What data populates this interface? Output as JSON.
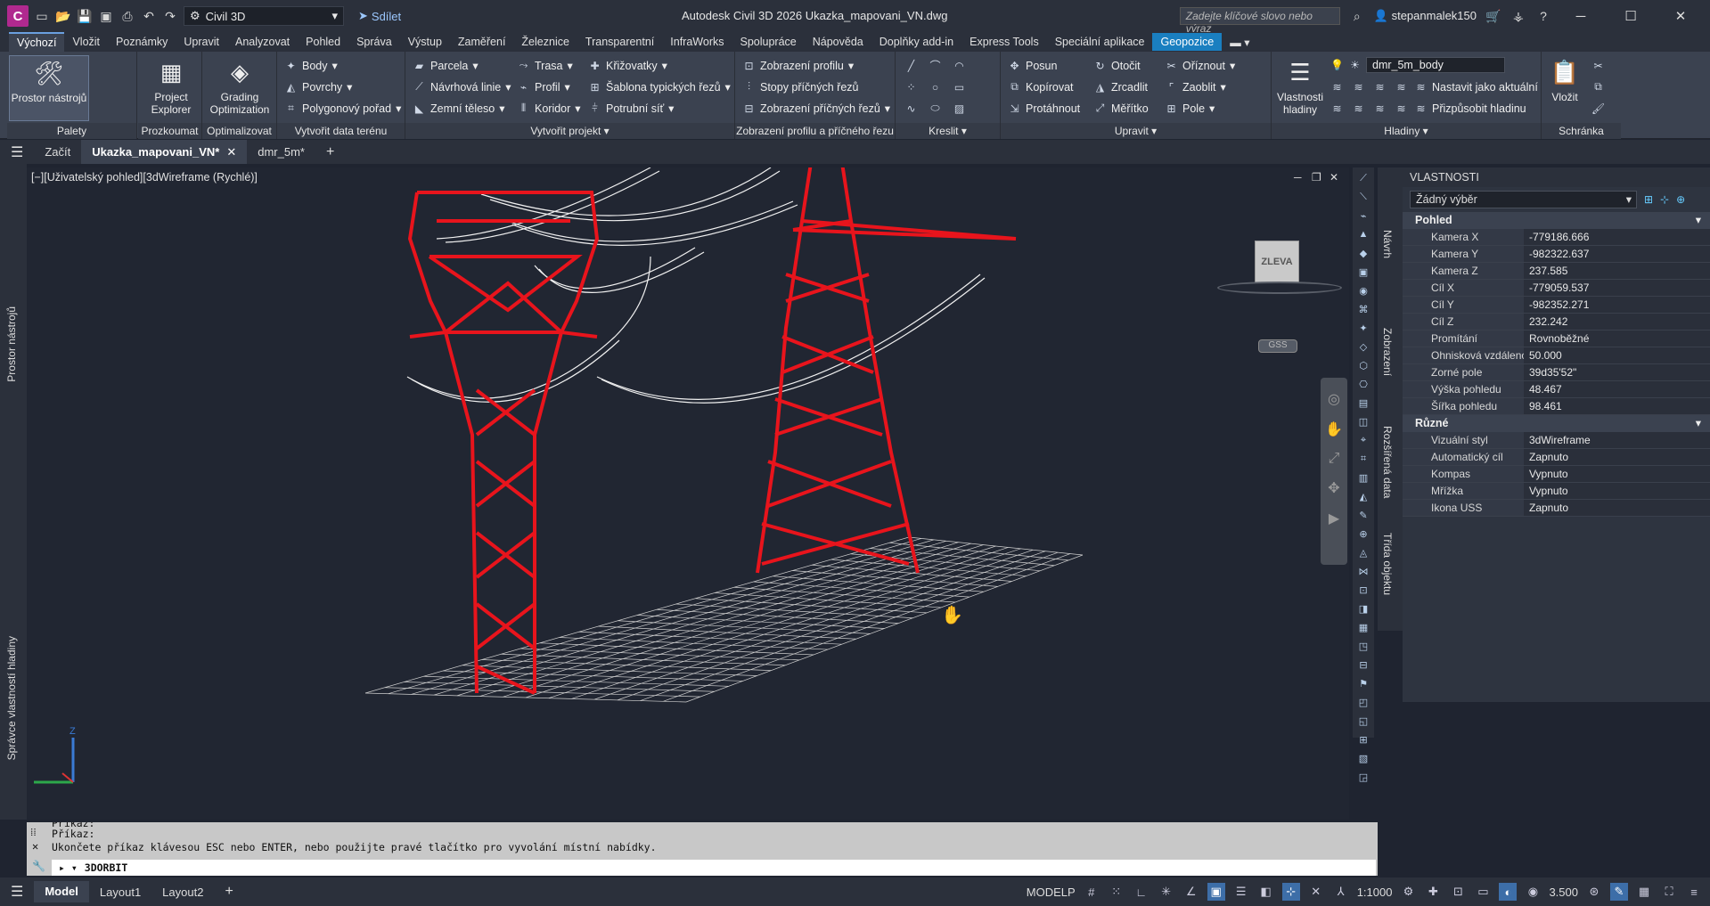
{
  "titlebar": {
    "app_letter": "C",
    "workspace": "Civil 3D",
    "share": "Sdílet",
    "title": "Autodesk Civil 3D 2026   Ukazka_mapovani_VN.dwg",
    "search_placeholder": "Zadejte klíčové slovo nebo výraz",
    "user": "stepanmalek150"
  },
  "menu": [
    "Výchozí",
    "Vložit",
    "Poznámky",
    "Upravit",
    "Analyzovat",
    "Pohled",
    "Správa",
    "Výstup",
    "Zaměření",
    "Železnice",
    "Transparentní",
    "InfraWorks",
    "Spolupráce",
    "Nápověda",
    "Doplňky add-in",
    "Express Tools",
    "Speciální aplikace",
    "Geopozice"
  ],
  "ribbon": {
    "palety": {
      "label": "Palety",
      "big": "Prostor nástrojů"
    },
    "prozkoumat": {
      "label": "Prozkoumat",
      "big": "Project Explorer"
    },
    "optimalizovat": {
      "label": "Optimalizovat",
      "big": "Grading Optimization"
    },
    "teren": {
      "label": "Vytvořit data terénu",
      "items": [
        "Body",
        "Povrchy",
        "Polygonový pořad"
      ]
    },
    "projekt": {
      "label": "Vytvořit projekt",
      "items": [
        "Parcela",
        "Návrhová linie",
        "Zemní těleso",
        "Trasa",
        "Profil",
        "Koridor",
        "Křižovatky",
        "Šablona typických řezů",
        "Potrubní síť"
      ]
    },
    "zobrazeni": {
      "label": "Zobrazení profilu a příčného řezu",
      "items": [
        "Zobrazení profilu",
        "Stopy příčných řezů",
        "Zobrazení příčných řezů"
      ]
    },
    "kreslit": {
      "label": "Kreslit"
    },
    "upravit": {
      "label": "Upravit",
      "items": [
        "Posun",
        "Kopírovat",
        "Protáhnout",
        "Otočit",
        "Zrcadlit",
        "Měřítko",
        "Oříznout",
        "Zaoblit",
        "Pole"
      ]
    },
    "hladiny": {
      "label": "Hladiny",
      "big": "Vlastnosti hladiny",
      "layer": "dmr_5m_body",
      "items": [
        "Nastavit jako aktuální",
        "Přizpůsobit hladinu"
      ]
    },
    "schranka": {
      "label": "Schránka",
      "big": "Vložit"
    }
  },
  "doctabs": [
    "Začít",
    "Ukazka_mapovani_VN*",
    "dmr_5m*"
  ],
  "left_labels": [
    "Prostor nástrojů",
    "Správce vlastností hladiny"
  ],
  "viewport": {
    "label": "[−][Uživatelský pohled][3dWireframe (Rychlé)]",
    "viewcube": "ZLEVA",
    "gss": "GSS"
  },
  "palette_tabs": [
    "Návrh",
    "Zobrazení",
    "Rozšířená data",
    "Třída objektu"
  ],
  "properties": {
    "title": "VLASTNOSTI",
    "selection": "Žádný výběr",
    "sections": [
      {
        "name": "Pohled",
        "rows": [
          [
            "Kamera X",
            "-779186.666"
          ],
          [
            "Kamera Y",
            "-982322.637"
          ],
          [
            "Kamera Z",
            "237.585"
          ],
          [
            "Cíl X",
            "-779059.537"
          ],
          [
            "Cíl Y",
            "-982352.271"
          ],
          [
            "Cíl Z",
            "232.242"
          ],
          [
            "Promítání",
            "Rovnoběžné"
          ],
          [
            "Ohnisková  vzdálenost...",
            "50.000"
          ],
          [
            "Zorné pole",
            "39d35'52\""
          ],
          [
            "Výška pohledu",
            "48.467"
          ],
          [
            "Šířka pohledu",
            "98.461"
          ]
        ]
      },
      {
        "name": "Různé",
        "rows": [
          [
            "Vizuální styl",
            "3dWireframe"
          ],
          [
            "Automatický cíl",
            "Zapnuto"
          ],
          [
            "Kompas",
            "Vypnuto"
          ],
          [
            "Mřížka",
            "Vypnuto"
          ],
          [
            "Ikona USS",
            "Zapnuto"
          ]
        ]
      }
    ]
  },
  "command": {
    "history": [
      "Příkaz:",
      "Příkaz:",
      "Ukončete příkaz klávesou ESC nebo ENTER, nebo použijte pravé tlačítko pro vyvolání místní nabídky."
    ],
    "current": "3DORBIT"
  },
  "status": {
    "tabs": [
      "Model",
      "Layout1",
      "Layout2"
    ],
    "model_label": "MODELP",
    "scale": "1:1000",
    "value": "3.500"
  }
}
